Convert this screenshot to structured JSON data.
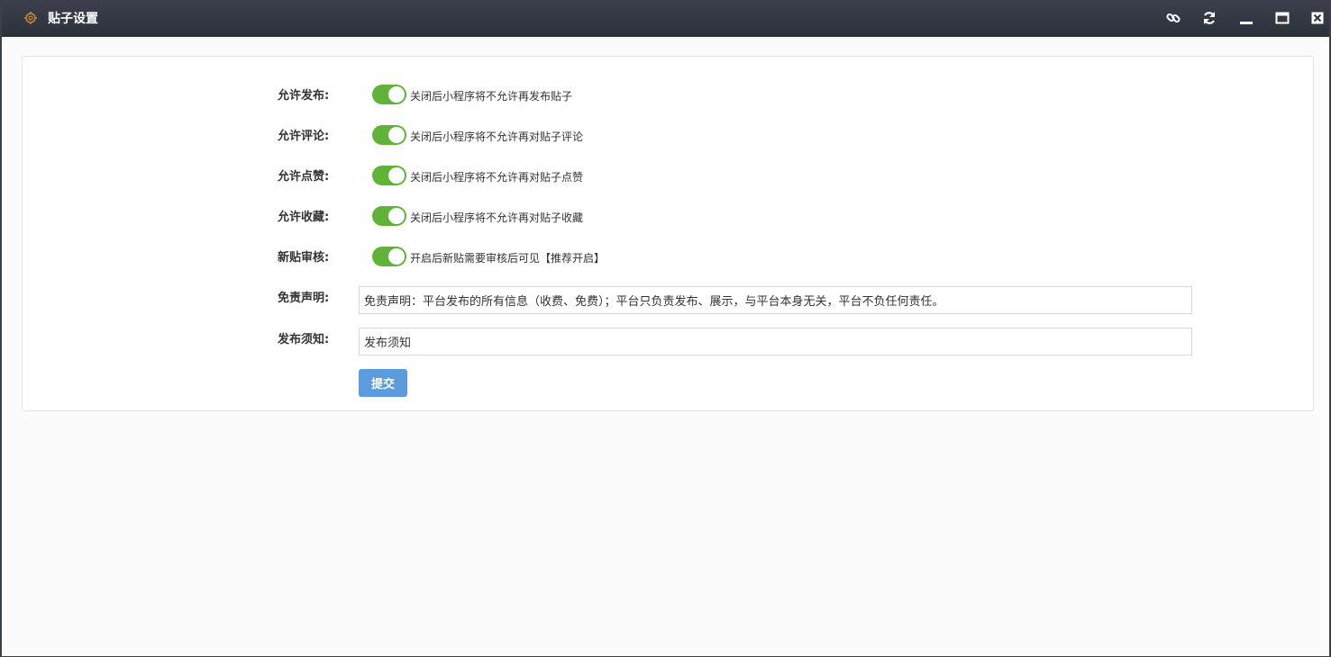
{
  "window": {
    "title": "贴子设置",
    "icons": [
      "settings-icon",
      "link-icon",
      "refresh-icon",
      "minimize-icon",
      "maximize-icon",
      "close-icon"
    ]
  },
  "form": {
    "toggles": [
      {
        "label": "允许发布:",
        "on": true,
        "hint": "关闭后小程序将不允许再发布贴子"
      },
      {
        "label": "允许评论:",
        "on": true,
        "hint": "关闭后小程序将不允许再对贴子评论"
      },
      {
        "label": "允许点赞:",
        "on": true,
        "hint": "关闭后小程序将不允许再对贴子点赞"
      },
      {
        "label": "允许收藏:",
        "on": true,
        "hint": "关闭后小程序将不允许再对贴子收藏"
      },
      {
        "label": "新贴审核:",
        "on": true,
        "hint": "开启后新贴需要审核后可见【推荐开启】"
      }
    ],
    "disclaimer": {
      "label": "免责声明:",
      "value": "免责声明：平台发布的所有信息（收费、免费）；平台只负责发布、展示，与平台本身无关，平台不负任何责任。"
    },
    "notice": {
      "label": "发布须知:",
      "value": "发布须知"
    },
    "submit_label": "提交"
  },
  "colors": {
    "titlebar": "#2f3440",
    "toggle_on": "#5fb336",
    "submit": "#5b9bde"
  }
}
